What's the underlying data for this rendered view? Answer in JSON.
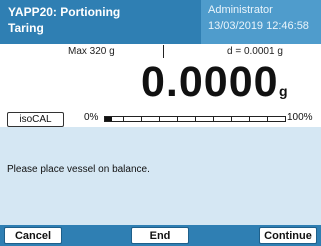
{
  "header": {
    "title_line1": "YAPP20: Portioning",
    "title_line2": "Taring",
    "user": "Administrator",
    "datetime": "13/03/2019 12:46:58"
  },
  "weighing": {
    "max": "Max 320 g",
    "readability": "d = 0.0001 g",
    "value": "0.0000",
    "unit": "g",
    "isocal_label": "isoCAL",
    "range_min": "0%",
    "range_max": "100%",
    "load_fraction": 0.04
  },
  "message": "Please place vessel on balance.",
  "footer": {
    "cancel_label": "Cancel",
    "end_label": "End",
    "continue_label": "Continue"
  }
}
